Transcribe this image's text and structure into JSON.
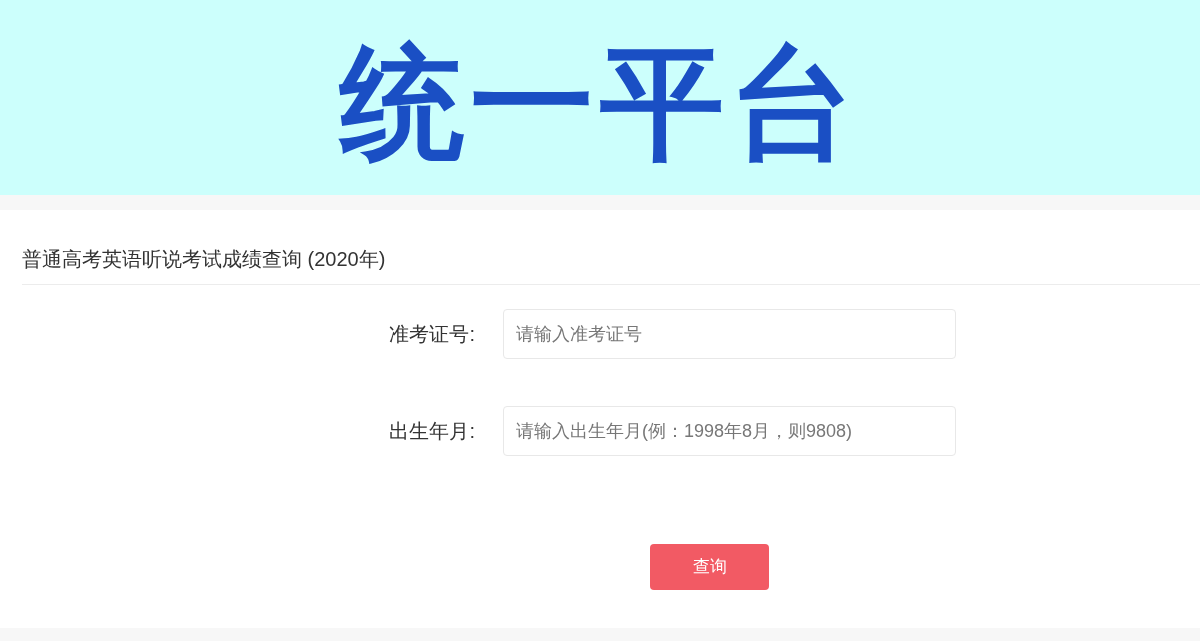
{
  "banner": {
    "title": "统一平台"
  },
  "form": {
    "title": "普通高考英语听说考试成绩查询 (2020年)",
    "fields": [
      {
        "label": "准考证号:",
        "placeholder": "请输入准考证号"
      },
      {
        "label": "出生年月:",
        "placeholder": "请输入出生年月(例：1998年8月，则9808)"
      }
    ],
    "submit": "查询"
  }
}
